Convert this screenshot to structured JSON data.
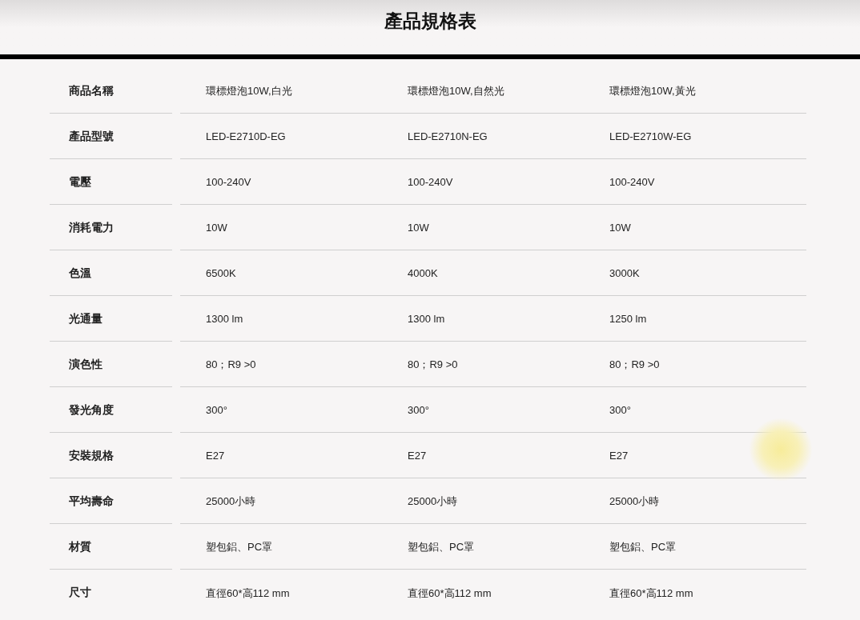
{
  "title": "產品規格表",
  "rows": [
    {
      "label": "商品名稱",
      "values": [
        "環標燈泡10W,白光",
        "環標燈泡10W,自然光",
        "環標燈泡10W,黃光"
      ]
    },
    {
      "label": "產品型號",
      "values": [
        "LED-E2710D-EG",
        "LED-E2710N-EG",
        "LED-E2710W-EG"
      ]
    },
    {
      "label": "電壓",
      "values": [
        "100-240V",
        "100-240V",
        "100-240V"
      ]
    },
    {
      "label": "消耗電力",
      "values": [
        "10W",
        "10W",
        "10W"
      ]
    },
    {
      "label": "色溫",
      "values": [
        "6500K",
        "4000K",
        "3000K"
      ]
    },
    {
      "label": "光通量",
      "values": [
        "1300 lm",
        "1300 lm",
        "1250 lm"
      ]
    },
    {
      "label": "演色性",
      "values": [
        "80；R9 >0",
        "80；R9 >0",
        "80；R9 >0"
      ]
    },
    {
      "label": "發光角度",
      "values": [
        "300°",
        "300°",
        "300°"
      ]
    },
    {
      "label": "安裝規格",
      "values": [
        "E27",
        "E27",
        "E27"
      ]
    },
    {
      "label": "平均壽命",
      "values": [
        "25000小時",
        "25000小時",
        "25000小時"
      ]
    },
    {
      "label": "材質",
      "values": [
        "塑包鋁、PC罩",
        "塑包鋁、PC罩",
        "塑包鋁、PC罩"
      ]
    },
    {
      "label": "尺寸",
      "values": [
        "直徑60*高112 mm",
        "直徑60*高112 mm",
        "直徑60*高112 mm"
      ]
    }
  ]
}
